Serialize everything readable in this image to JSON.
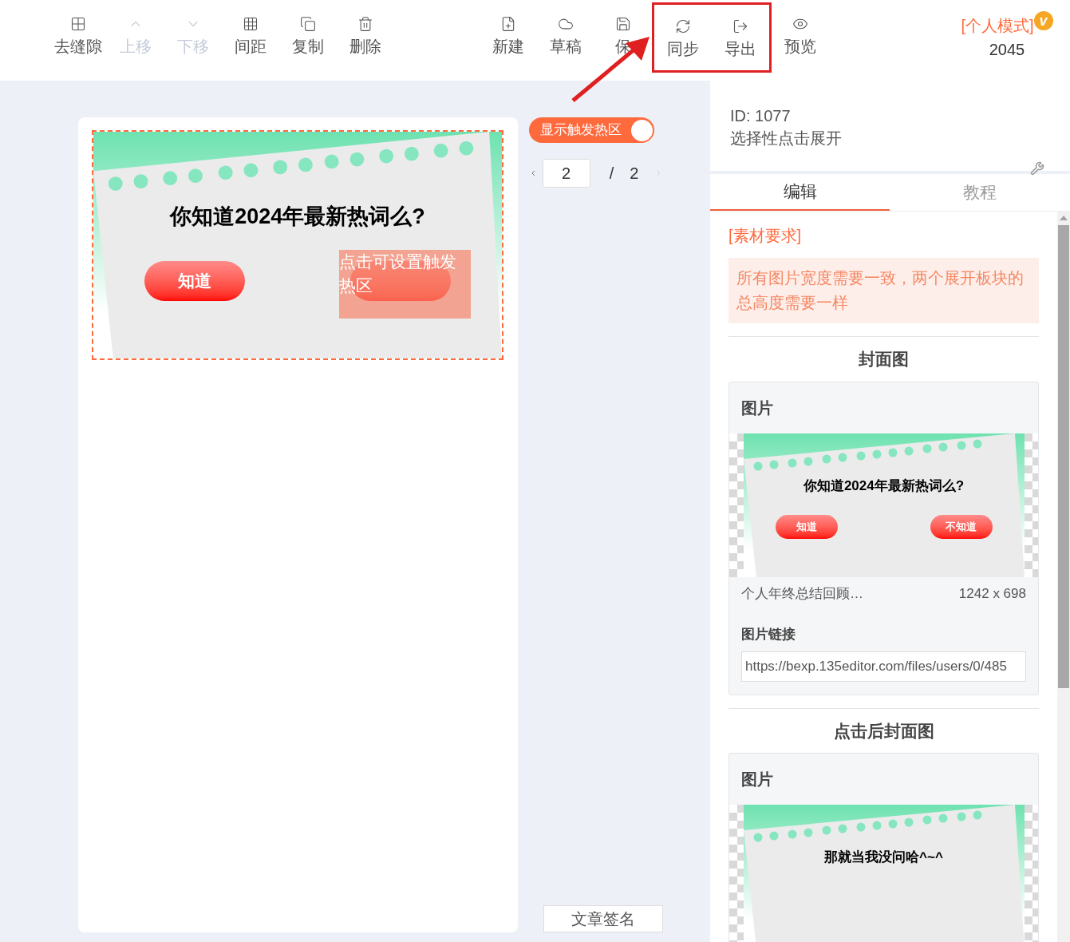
{
  "toolbar": {
    "left": [
      {
        "label": "去缝隙",
        "disabled": false
      },
      {
        "label": "上移",
        "disabled": true
      },
      {
        "label": "下移",
        "disabled": true
      },
      {
        "label": "间距",
        "disabled": false
      },
      {
        "label": "复制",
        "disabled": false
      },
      {
        "label": "删除",
        "disabled": false
      }
    ],
    "middle": [
      {
        "label": "新建",
        "disabled": false,
        "highlighted": false
      },
      {
        "label": "草稿",
        "disabled": false,
        "highlighted": false
      },
      {
        "label": "保",
        "disabled": false,
        "highlighted": false
      },
      {
        "label": "同步",
        "disabled": false,
        "highlighted": true
      },
      {
        "label": "导出",
        "disabled": false,
        "highlighted": true
      },
      {
        "label": "预览",
        "disabled": false,
        "highlighted": false
      }
    ],
    "mode": {
      "label": "[个人模式]",
      "badge": "v",
      "count": "2045"
    }
  },
  "canvas": {
    "poster": {
      "title": "你知道2024年最新热词么?",
      "buttons": [
        "知道"
      ],
      "covered_button": true
    },
    "hotspot": {
      "label": "点击可设置触发热区"
    }
  },
  "hotspot_toggle": {
    "label": "显示触发热区",
    "on": true
  },
  "pagination": {
    "current": "2",
    "separator": "/",
    "total": "2"
  },
  "signature_button": "文章签名",
  "panel": {
    "id": "ID: 1077",
    "name": "选择性点击展开",
    "tabs": [
      {
        "label": "编辑",
        "selected": true
      },
      {
        "label": "教程",
        "selected": false
      }
    ],
    "requirements": {
      "title": "[素材要求]",
      "text": "所有图片宽度需要一致，两个展开板块的总高度需要一样"
    },
    "sections": [
      {
        "title": "封面图",
        "card_title": "图片",
        "image": {
          "title": "你知道2024年最新热词么?",
          "buttons": [
            "知道",
            "不知道"
          ]
        },
        "filename": "个人年终总结回顾…",
        "size": "1242 x 698",
        "link_label": "图片链接",
        "link": "https://bexp.135editor.com/files/users/0/485"
      },
      {
        "title": "点击后封面图",
        "card_title": "图片",
        "image": {
          "title": "那就当我没问哈^~^"
        }
      }
    ]
  }
}
